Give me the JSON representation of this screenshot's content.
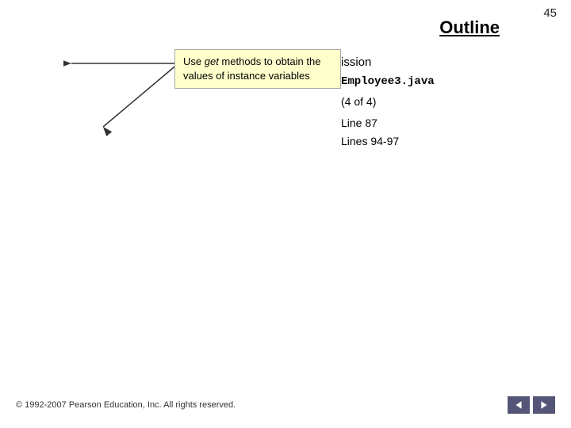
{
  "page": {
    "number": "45",
    "title": "Outline"
  },
  "tooltip": {
    "text_part1": "Use ",
    "italic": "get",
    "text_part2": " methods to obtain the values of instance variables"
  },
  "items": {
    "commission": "ission",
    "employee_file": "Employee3.java",
    "of_count": "(4 of 4)",
    "line87": "Line 87",
    "lines94": "Lines 94-97"
  },
  "footer": {
    "copyright": "© 1992-2007 Pearson Education, Inc.  All rights reserved."
  },
  "nav": {
    "back_label": "◀",
    "forward_label": "▶"
  }
}
